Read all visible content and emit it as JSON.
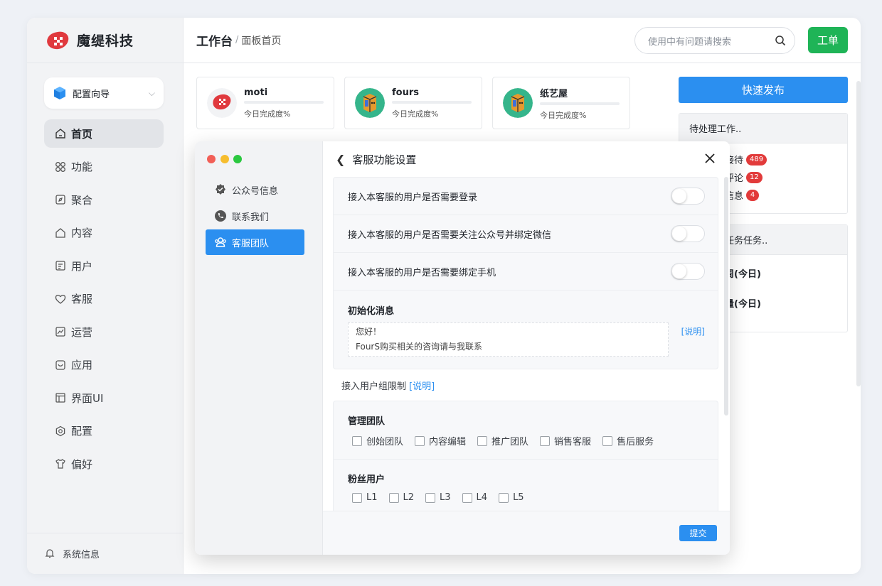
{
  "brand": {
    "name": "魔缇科技"
  },
  "sidebar": {
    "wizard_label": "配置向导",
    "items": [
      {
        "label": "首页",
        "icon": "home-icon",
        "active": true
      },
      {
        "label": "功能",
        "icon": "grid-icon"
      },
      {
        "label": "聚合",
        "icon": "compass-icon"
      },
      {
        "label": "内容",
        "icon": "content-icon"
      },
      {
        "label": "用户",
        "icon": "user-card-icon"
      },
      {
        "label": "客服",
        "icon": "heart-icon"
      },
      {
        "label": "运营",
        "icon": "chart-icon"
      },
      {
        "label": "应用",
        "icon": "app-icon"
      },
      {
        "label": "界面UI",
        "icon": "layout-icon"
      },
      {
        "label": "配置",
        "icon": "settings-icon"
      },
      {
        "label": "偏好",
        "icon": "shirt-icon"
      }
    ],
    "system_label": "系统信息"
  },
  "header": {
    "crumb_main": "工作台",
    "crumb_sep": "/",
    "crumb_sub": "面板首页",
    "search_placeholder": "使用中有问题请搜索",
    "ticket_label": "工单"
  },
  "cards": [
    {
      "name": "moti",
      "progress_label": "今日完成度%"
    },
    {
      "name": "fours",
      "progress_label": "今日完成度%"
    },
    {
      "name": "纸艺屋",
      "progress_label": "今日完成度%"
    }
  ],
  "right": {
    "publish_label": "快速发布",
    "pending": {
      "title": "待处理工作..",
      "rows": [
        {
          "label": "接待",
          "count": "489"
        },
        {
          "label": "评论",
          "count": "12"
        },
        {
          "label": "信息",
          "count": "4"
        }
      ]
    },
    "tasks": {
      "title": "任务任务..",
      "rows": [
        "周(今日)",
        "量(今日)"
      ]
    }
  },
  "overlay": {
    "nav": [
      {
        "label": "公众号信息",
        "icon": "verified-icon"
      },
      {
        "label": "联系我们",
        "icon": "phone-icon"
      },
      {
        "label": "客服团队",
        "icon": "team-icon",
        "active": true
      }
    ],
    "title": "客服功能设置",
    "settings": [
      "接入本客服的用户是否需要登录",
      "接入本客服的用户是否需要关注公众号并绑定微信",
      "接入本客服的用户是否需要绑定手机"
    ],
    "init_label": "初始化消息",
    "init_message": "您好！\nFourS购买相关的咨询请与我联系",
    "explain": "[说明]",
    "group_limit_label": "接入用户组限制",
    "groups": [
      {
        "label": "管理团队",
        "options": [
          "创始团队",
          "内容编辑",
          "推广团队",
          "销售客服",
          "售后服务"
        ]
      },
      {
        "label": "粉丝用户",
        "options": [
          "L1",
          "L2",
          "L3",
          "L4",
          "L5"
        ]
      }
    ],
    "submit_label": "提交"
  },
  "colors": {
    "accent": "#2b8ff0",
    "green": "#1fb457",
    "badge": "#e23b3b"
  }
}
